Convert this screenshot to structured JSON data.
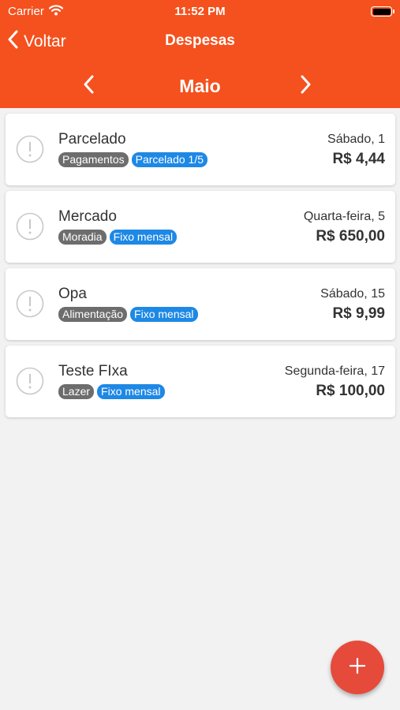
{
  "status_bar": {
    "carrier": "Carrier",
    "time": "11:52 PM"
  },
  "nav": {
    "back_label": "Voltar",
    "title": "Despesas"
  },
  "month": {
    "label": "Maio"
  },
  "expenses": [
    {
      "name": "Parcelado",
      "category": "Pagamentos",
      "recurrence": "Parcelado 1/5",
      "date": "Sábado, 1",
      "amount": "R$ 4,44"
    },
    {
      "name": "Mercado",
      "category": "Moradia",
      "recurrence": "Fixo mensal",
      "date": "Quarta-feira, 5",
      "amount": "R$ 650,00"
    },
    {
      "name": "Opa",
      "category": "Alimentação",
      "recurrence": "Fixo mensal",
      "date": "Sábado, 15",
      "amount": "R$ 9,99"
    },
    {
      "name": "Teste FIxa",
      "category": "Lazer",
      "recurrence": "Fixo mensal",
      "date": "Segunda-feira, 17",
      "amount": "R$ 100,00"
    }
  ],
  "icons": {
    "back": "chevron-left-icon",
    "prev_month": "chevron-left-icon",
    "next_month": "chevron-right-icon",
    "item_status": "alert-circle-icon",
    "add": "plus-icon",
    "wifi": "wifi-icon",
    "battery": "battery-icon"
  },
  "colors": {
    "header": "#f4511e",
    "fab": "#e64a3b",
    "category_tag": "#6d6d6d",
    "recurrence_tag": "#1e88e5",
    "background": "#f2f2f2"
  }
}
